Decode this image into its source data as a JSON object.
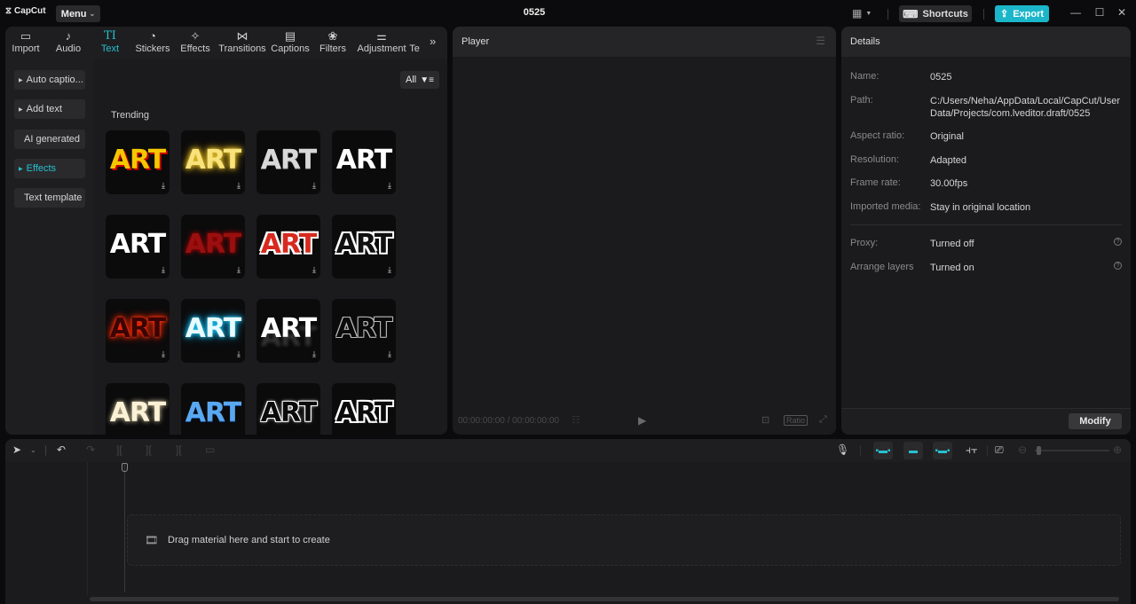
{
  "app": {
    "logo": "CapCut",
    "menu_label": "Menu",
    "project_title": "0525",
    "shortcuts_label": "Shortcuts",
    "export_label": "Export",
    "accent_color": "#1bb6c9"
  },
  "toolbar": {
    "tabs": [
      {
        "label": "Import",
        "icon": "import-icon",
        "glyph": "▭"
      },
      {
        "label": "Audio",
        "icon": "audio-icon",
        "glyph": "♪"
      },
      {
        "label": "Text",
        "icon": "text-icon",
        "glyph": "TI"
      },
      {
        "label": "Stickers",
        "icon": "sticker-icon",
        "glyph": "◔"
      },
      {
        "label": "Effects",
        "icon": "effects-icon",
        "glyph": "✧"
      },
      {
        "label": "Transitions",
        "icon": "transitions-icon",
        "glyph": "⋈"
      },
      {
        "label": "Captions",
        "icon": "captions-icon",
        "glyph": "▤"
      },
      {
        "label": "Filters",
        "icon": "filters-icon",
        "glyph": "❀"
      },
      {
        "label": "Adjustment",
        "icon": "adjustment-icon",
        "glyph": "⚌"
      },
      {
        "label": "Te",
        "icon": "",
        "glyph": ""
      }
    ],
    "active_tab": "Text",
    "more_glyph": "»"
  },
  "side_nav": {
    "items": [
      {
        "label": "Auto captio...",
        "arrow": true,
        "active": false
      },
      {
        "label": "Add text",
        "arrow": true,
        "active": false
      },
      {
        "label": "AI generated",
        "arrow": false,
        "active": false
      },
      {
        "label": "Effects",
        "arrow": true,
        "active": true
      },
      {
        "label": "Text template",
        "arrow": false,
        "active": false
      }
    ]
  },
  "content": {
    "filter_label": "All",
    "section_title": "Trending",
    "tiles": [
      {
        "text": "ART",
        "style": "yellow-red-shadow"
      },
      {
        "text": "ART",
        "style": "yellow-glow"
      },
      {
        "text": "ART",
        "style": "silver-gradient"
      },
      {
        "text": "ART",
        "style": "white-plain"
      },
      {
        "text": "ART",
        "style": "white-bold"
      },
      {
        "text": "ART",
        "style": "dark-red-glow"
      },
      {
        "text": "ART",
        "style": "red-white-outline"
      },
      {
        "text": "ART",
        "style": "black-white-outline"
      },
      {
        "text": "ART",
        "style": "red-neon"
      },
      {
        "text": "ART",
        "style": "cyan-neon"
      },
      {
        "text": "ART",
        "style": "white-reflection"
      },
      {
        "text": "ART",
        "style": "hollow-outline"
      },
      {
        "text": "ART",
        "style": "cream-glow"
      },
      {
        "text": "ART",
        "style": "blue-gradient"
      },
      {
        "text": "ART",
        "style": "double-outline"
      },
      {
        "text": "ART",
        "style": "thick-white-outline"
      }
    ]
  },
  "player": {
    "title": "Player",
    "timecode": "00:00:00:00 / 00:00:00:00",
    "ratio_label": "Ratio"
  },
  "details": {
    "title": "Details",
    "rows": [
      {
        "label": "Name:",
        "value": "0525"
      },
      {
        "label": "Path:",
        "value": "C:/Users/Neha/AppData/Local/CapCut/User Data/Projects/com.lveditor.draft/0525"
      },
      {
        "label": "Aspect ratio:",
        "value": "Original"
      },
      {
        "label": "Resolution:",
        "value": "Adapted"
      },
      {
        "label": "Frame rate:",
        "value": "30.00fps"
      },
      {
        "label": "Imported media:",
        "value": "Stay in original location"
      },
      {
        "label": "Proxy:",
        "value": "Turned off"
      },
      {
        "label": "Arrange layers",
        "value": "Turned on"
      }
    ],
    "modify_label": "Modify"
  },
  "timeline": {
    "drop_hint": "Drag material here and start to create"
  }
}
